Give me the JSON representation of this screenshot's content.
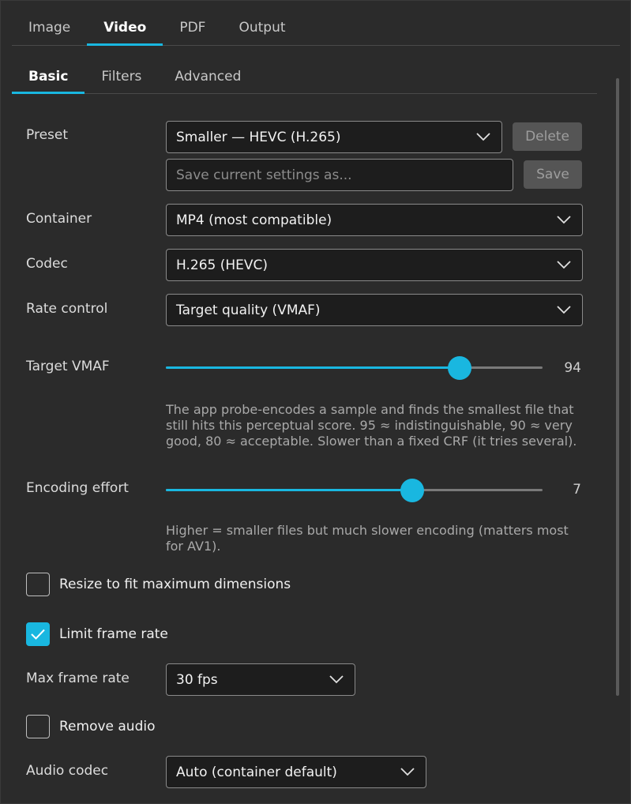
{
  "top_tabs": [
    {
      "label": "Image",
      "active": false
    },
    {
      "label": "Video",
      "active": true
    },
    {
      "label": "PDF",
      "active": false
    },
    {
      "label": "Output",
      "active": false
    }
  ],
  "sub_tabs": [
    {
      "label": "Basic",
      "active": true
    },
    {
      "label": "Filters",
      "active": false
    },
    {
      "label": "Advanced",
      "active": false
    }
  ],
  "preset": {
    "label": "Preset",
    "value": "Smaller — HEVC (H.265)",
    "delete_label": "Delete",
    "save_placeholder": "Save current settings as...",
    "save_label": "Save"
  },
  "container": {
    "label": "Container",
    "value": "MP4 (most compatible)"
  },
  "codec": {
    "label": "Codec",
    "value": "H.265 (HEVC)"
  },
  "rate_control": {
    "label": "Rate control",
    "value": "Target quality (VMAF)"
  },
  "target_vmaf": {
    "label": "Target VMAF",
    "value": "94",
    "fraction": 0.78,
    "help": "The app probe-encodes a sample and finds the smallest file that still hits this perceptual score. 95 ≈ indistinguishable, 90 ≈ very good, 80 ≈ acceptable. Slower than a fixed CRF (it tries several)."
  },
  "encoding_effort": {
    "label": "Encoding effort",
    "value": "7",
    "fraction": 0.655,
    "help": "Higher = smaller files but much slower encoding (matters most for AV1)."
  },
  "resize": {
    "label": "Resize to fit maximum dimensions",
    "checked": false
  },
  "limit_frame_rate": {
    "label": "Limit frame rate",
    "checked": true
  },
  "max_frame_rate": {
    "label": "Max frame rate",
    "value": "30 fps"
  },
  "remove_audio": {
    "label": "Remove audio",
    "checked": false
  },
  "audio_codec": {
    "label": "Audio codec",
    "value": "Auto (container default)"
  },
  "colors": {
    "accent": "#19b7e0",
    "background": "#2b2b2b",
    "field": "#1d1d1d"
  }
}
